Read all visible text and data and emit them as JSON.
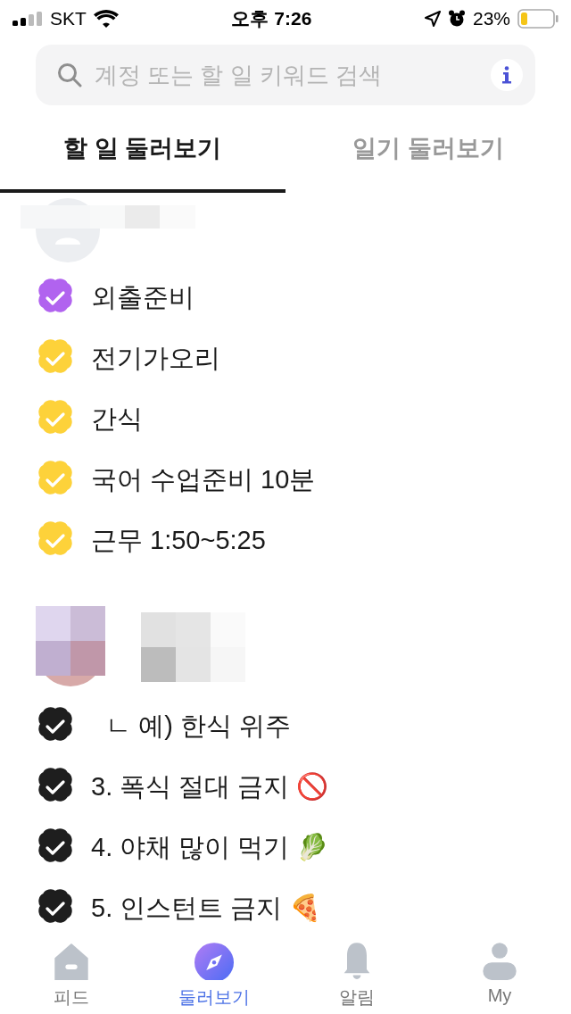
{
  "status_bar": {
    "carrier": "SKT",
    "time": "오후 7:26",
    "battery": "23%"
  },
  "search": {
    "placeholder": "계정 또는 할 일 키워드 검색"
  },
  "tabs": [
    {
      "label": "할 일 둘러보기",
      "selected": true
    },
    {
      "label": "일기 둘러보기",
      "selected": false
    }
  ],
  "groups": [
    {
      "kind": "default",
      "items": [
        {
          "text": "외출준비",
          "checked": true,
          "color": "#b163ef"
        },
        {
          "text": "전기가오리",
          "checked": true,
          "color": "#fdd23a"
        },
        {
          "text": "간식",
          "checked": true,
          "color": "#fdd23a"
        },
        {
          "text": "국어 수업준비 10분",
          "checked": true,
          "color": "#fdd23a"
        },
        {
          "text": "근무 1:50~5:25",
          "checked": true,
          "color": "#fdd23a"
        }
      ]
    },
    {
      "items": [
        {
          "text": "  ㄴ 예) 한식 위주",
          "checked": true,
          "color": "#1e1e1e"
        },
        {
          "text": "3. 폭식 절대 금지 🚫",
          "checked": true,
          "color": "#1e1e1e"
        },
        {
          "text": "4. 야채 많이 먹기 🥬",
          "checked": true,
          "color": "#1e1e1e"
        },
        {
          "text": "5. 인스턴트 금지 🍕",
          "checked": true,
          "color": "#1e1e1e"
        }
      ]
    }
  ],
  "nav": [
    {
      "label": "피드",
      "kind": "home",
      "selected": false
    },
    {
      "label": "둘러보기",
      "kind": "compass",
      "selected": true
    },
    {
      "label": "알림",
      "kind": "bell",
      "selected": false
    },
    {
      "label": "My",
      "kind": "person",
      "selected": false
    }
  ]
}
